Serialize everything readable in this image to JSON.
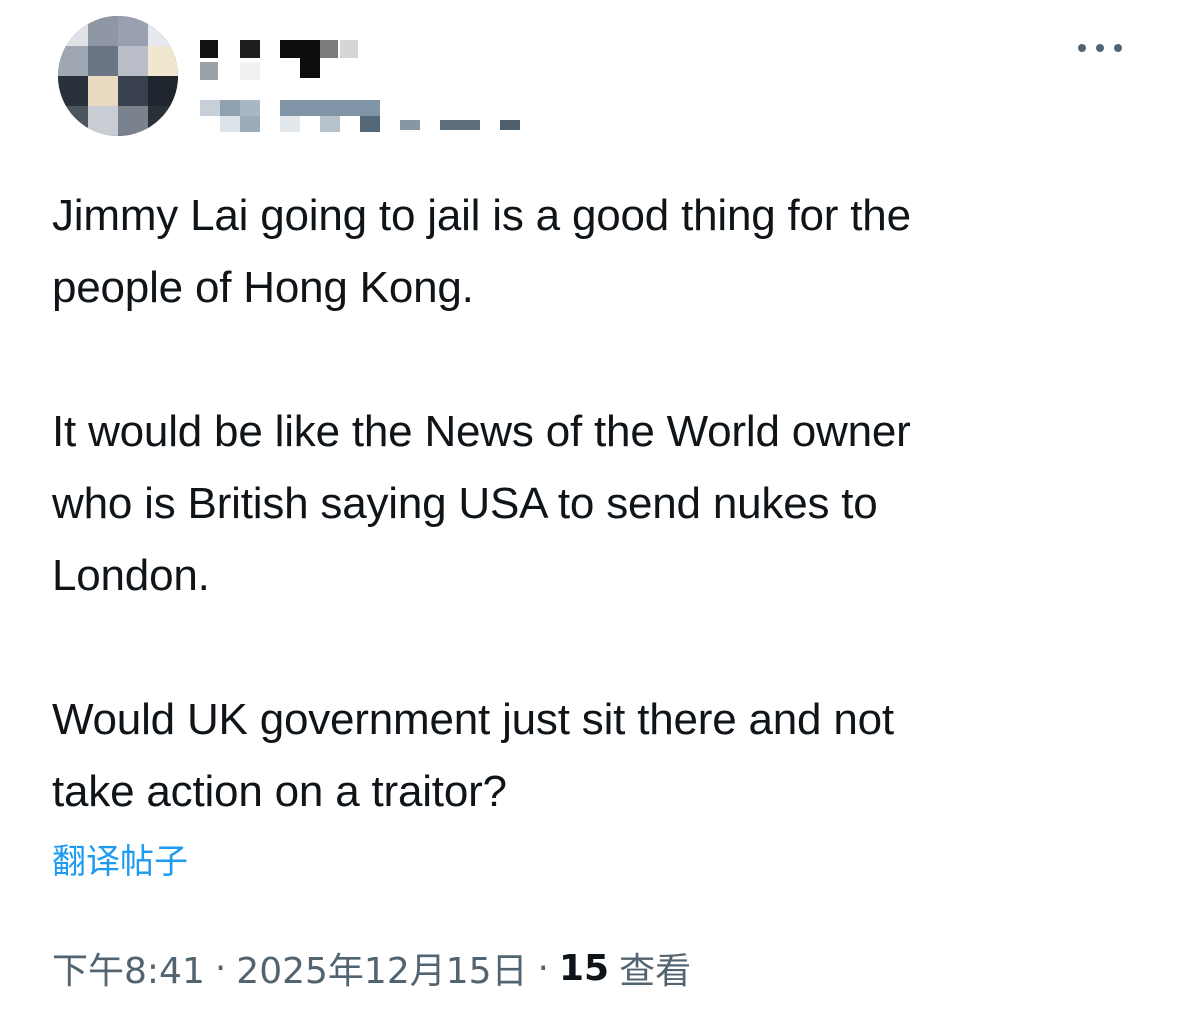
{
  "tweet": {
    "paragraphs": [
      "Jimmy Lai going to jail is a good thing for the\npeople of Hong Kong.",
      "It would be like the News of the World owner\nwho is British saying USA to send nukes to\nLondon.",
      "Would UK government just sit there and not\ntake action on a traitor?"
    ],
    "translate_label": "翻译帖子"
  },
  "meta": {
    "time": "下午8:41",
    "date": "2025年12月15日",
    "separator": "·",
    "views_count": "15",
    "views_label": "查看"
  },
  "icons": {
    "more": "more-horizontal-icon"
  },
  "colors": {
    "text": "#0f1419",
    "secondary": "#536471",
    "link": "#1d9bf0"
  }
}
